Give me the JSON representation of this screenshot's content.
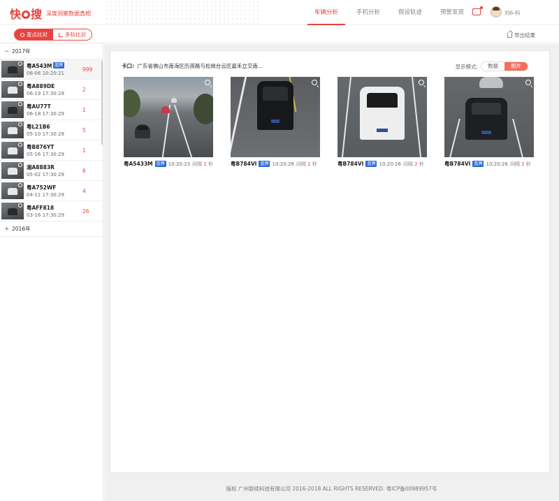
{
  "header": {
    "logo_text": "快搜",
    "logo_sub": "深度洞察数据真相",
    "nav": [
      {
        "label": "车辆分析",
        "active": true
      },
      {
        "label": "手机分析",
        "active": false
      },
      {
        "label": "假设轨迹",
        "active": false
      },
      {
        "label": "预警发现",
        "active": false
      }
    ],
    "user_name": "刘6-科"
  },
  "toolbar": {
    "segments": [
      {
        "label": "查点比对",
        "active": true
      },
      {
        "label": "多轨比对",
        "active": false
      }
    ],
    "export_label": "导出结果"
  },
  "sidebar": {
    "years": [
      {
        "label": "2017年",
        "sign": "−"
      },
      {
        "label": "2016年",
        "sign": "+"
      }
    ],
    "records": [
      {
        "plate": "粤A543M",
        "tag": "蓝牌",
        "time": "06-06 10:20:21",
        "count": "999",
        "active": true
      },
      {
        "plate": "粤A889DE",
        "tag": "",
        "time": "06-19 17:30:29",
        "count": "2",
        "active": false
      },
      {
        "plate": "粤AU77T",
        "tag": "",
        "time": "06-18 17:30:29",
        "count": "1",
        "active": false
      },
      {
        "plate": "粤L21B6",
        "tag": "",
        "time": "05-10 17:30:29",
        "count": "5",
        "active": false
      },
      {
        "plate": "粤B876YT",
        "tag": "",
        "time": "05-16 17:30:29",
        "count": "1",
        "active": false
      },
      {
        "plate": "湘A8883R",
        "tag": "",
        "time": "05-02 17:30:29",
        "count": "6",
        "active": false
      },
      {
        "plate": "粤A752WF",
        "tag": "",
        "time": "04-11 17:30:29",
        "count": "4",
        "active": false
      },
      {
        "plate": "粤AFF818",
        "tag": "",
        "time": "03-16 17:30:29",
        "count": "26",
        "active": false
      }
    ]
  },
  "main": {
    "checkpoint_label": "卡口:",
    "checkpoint_value": "广东省佛山市南海区历孩路与松岗台云区嘉禾立交南...",
    "mode_label": "显示模式:",
    "mode_options": [
      {
        "label": "数据",
        "active": false
      },
      {
        "label": "照片",
        "active": true
      }
    ],
    "cards": [
      {
        "plate": "粤A5433M",
        "tag": "蓝牌",
        "time": "10:20:23",
        "interval_label": "间隔",
        "interval_value": "2",
        "interval_unit": "秒"
      },
      {
        "plate": "粤B784VI",
        "tag": "蓝牌",
        "time": "10:20:26",
        "interval_label": "间隔",
        "interval_value": "2",
        "interval_unit": "秒"
      },
      {
        "plate": "粤B784VI",
        "tag": "蓝牌",
        "time": "10:20:26",
        "interval_label": "间隔",
        "interval_value": "2",
        "interval_unit": "秒"
      },
      {
        "plate": "粤B784VI",
        "tag": "蓝牌",
        "time": "10:20:26",
        "interval_label": "间隔",
        "interval_value": "2",
        "interval_unit": "秒"
      }
    ]
  },
  "footer": {
    "text": "版权 广州联续科技有限公司 2016-2018 ALL RIGHTS RESERVED. 粤ICP备00989957号"
  },
  "colors": {
    "accent": "#e8433f",
    "tag_blue": "#2f6bd8",
    "background": "#f0f0f0"
  }
}
